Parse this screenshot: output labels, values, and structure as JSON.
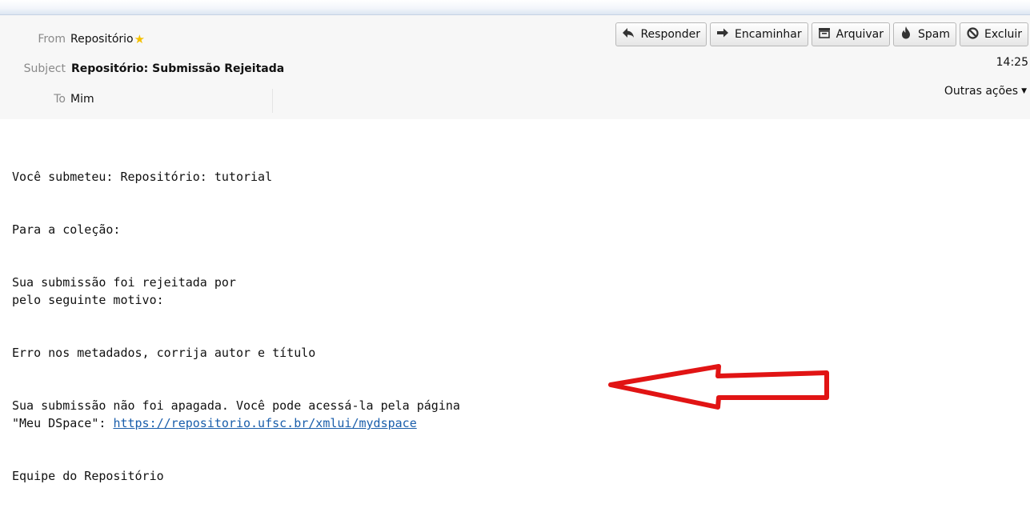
{
  "header": {
    "from_label": "From",
    "from_value": "Repositório",
    "subject_label": "Subject",
    "subject_value": "Repositório: Submissão Rejeitada",
    "to_label": "To",
    "to_value": "Mim",
    "time": "14:25",
    "other_actions": "Outras ações",
    "star_icon": "star-icon"
  },
  "toolbar": {
    "reply": "Responder",
    "forward": "Encaminhar",
    "archive": "Arquivar",
    "spam": "Spam",
    "delete": "Excluir"
  },
  "body": {
    "line1": "Você submeteu: Repositório: tutorial",
    "line2": "Para a coleção:",
    "line3a": "Sua submissão foi rejeitada por",
    "line3b": "pelo seguinte motivo:",
    "line4": "Erro nos metadados, corrija autor e título",
    "line5a": "Sua submissão não foi apagada. Você pode acessá-la pela página",
    "line5b_prefix": "\"Meu DSpace\": ",
    "link": "https://repositorio.ufsc.br/xmlui/mydspace",
    "signature": "Equipe do Repositório"
  },
  "annotation": {
    "arrow_color": "#e11414"
  }
}
